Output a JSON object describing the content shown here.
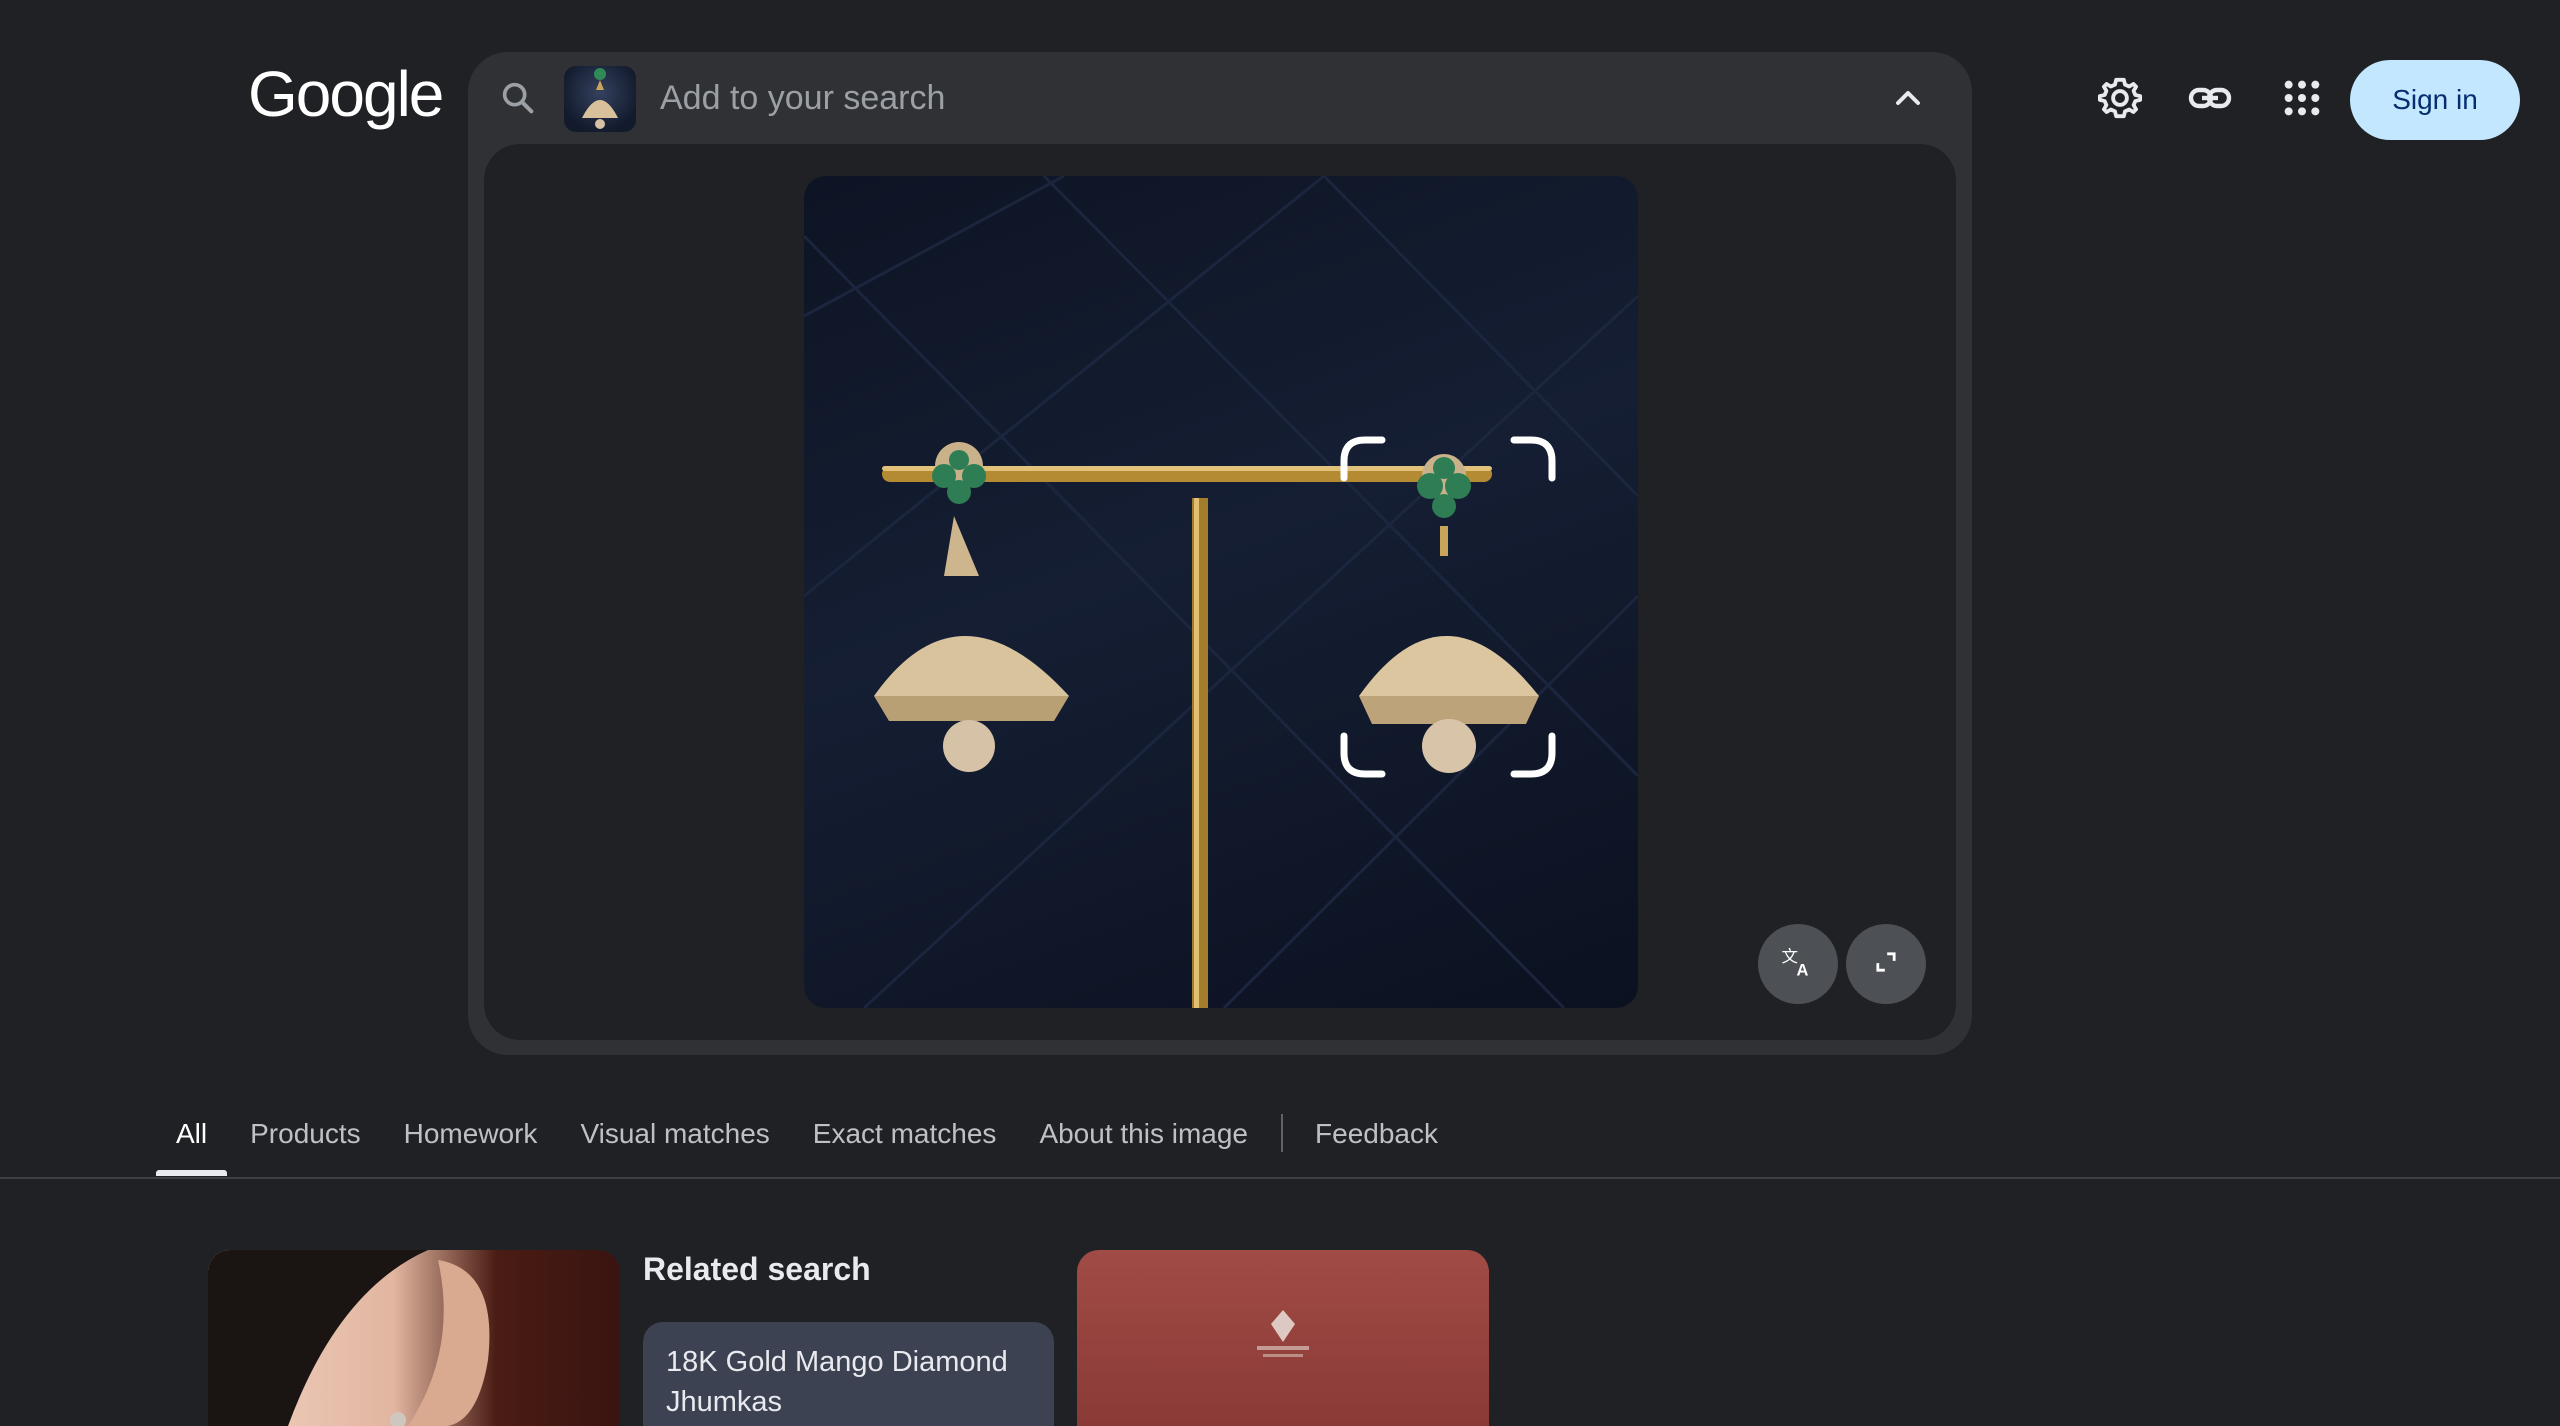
{
  "header": {
    "logo_text": "Google",
    "search": {
      "placeholder": "Add to your search",
      "value": ""
    },
    "icons": [
      "search-icon",
      "collapse-chevron-icon",
      "settings-icon",
      "link-icon",
      "apps-icon"
    ],
    "sign_in_label": "Sign in"
  },
  "image_panel": {
    "tools": [
      "translate-icon",
      "expand-icon"
    ]
  },
  "tabs": [
    {
      "label": "All",
      "active": true
    },
    {
      "label": "Products",
      "active": false
    },
    {
      "label": "Homework",
      "active": false
    },
    {
      "label": "Visual matches",
      "active": false
    },
    {
      "label": "Exact matches",
      "active": false
    },
    {
      "label": "About this image",
      "active": false
    }
  ],
  "feedback_label": "Feedback",
  "results": {
    "related_search_title": "Related search",
    "related_search_items": [
      "18K Gold Mango Diamond Jhumkas"
    ]
  },
  "colors": {
    "background": "#202124",
    "card": "#303134",
    "sign_in_bg": "#c2e7ff",
    "sign_in_text": "#062e6f"
  }
}
